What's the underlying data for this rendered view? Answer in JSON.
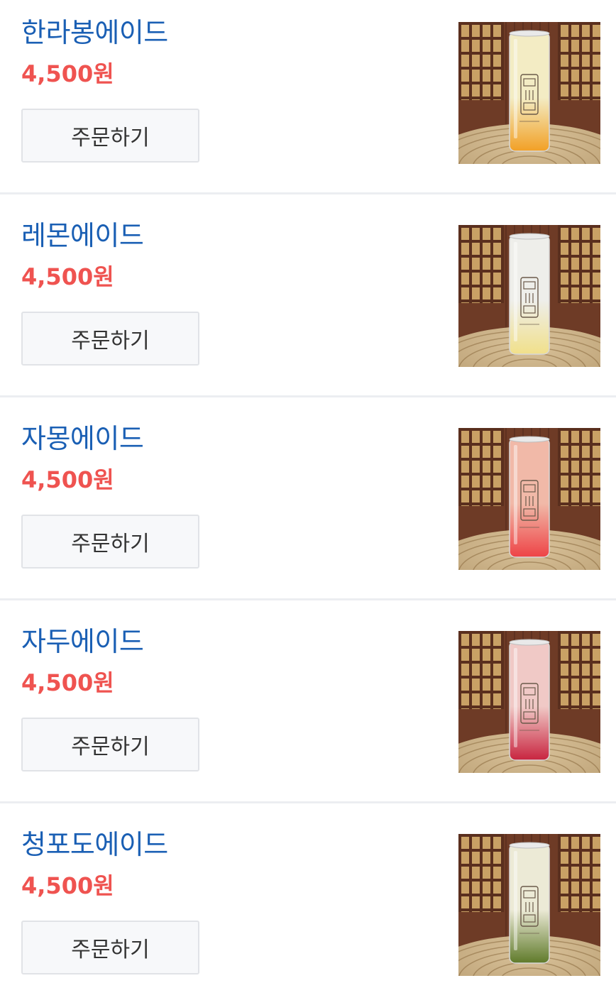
{
  "colors": {
    "name": "#1a5fb4",
    "price": "#ef5350",
    "button_bg": "#f7f8fa",
    "button_border": "#e1e3e7",
    "divider": "#eceef1"
  },
  "menu": [
    {
      "name": "한라봉에이드",
      "price": "4,500원",
      "order_label": "주문하기",
      "image": "drink-photo",
      "drink_color_top": "#f3ecc4",
      "drink_color_bottom": "#f2a025"
    },
    {
      "name": "레몬에이드",
      "price": "4,500원",
      "order_label": "주문하기",
      "image": "drink-photo",
      "drink_color_top": "#eeeeea",
      "drink_color_bottom": "#f1e08a"
    },
    {
      "name": "자몽에이드",
      "price": "4,500원",
      "order_label": "주문하기",
      "image": "drink-photo",
      "drink_color_top": "#f1b9a8",
      "drink_color_bottom": "#ee4346"
    },
    {
      "name": "자두에이드",
      "price": "4,500원",
      "order_label": "주문하기",
      "image": "drink-photo",
      "drink_color_top": "#f0c9c6",
      "drink_color_bottom": "#c8243f"
    },
    {
      "name": "청포도에이드",
      "price": "4,500원",
      "order_label": "주문하기",
      "image": "drink-photo",
      "drink_color_top": "#ecead6",
      "drink_color_bottom": "#5f7a2a"
    }
  ]
}
